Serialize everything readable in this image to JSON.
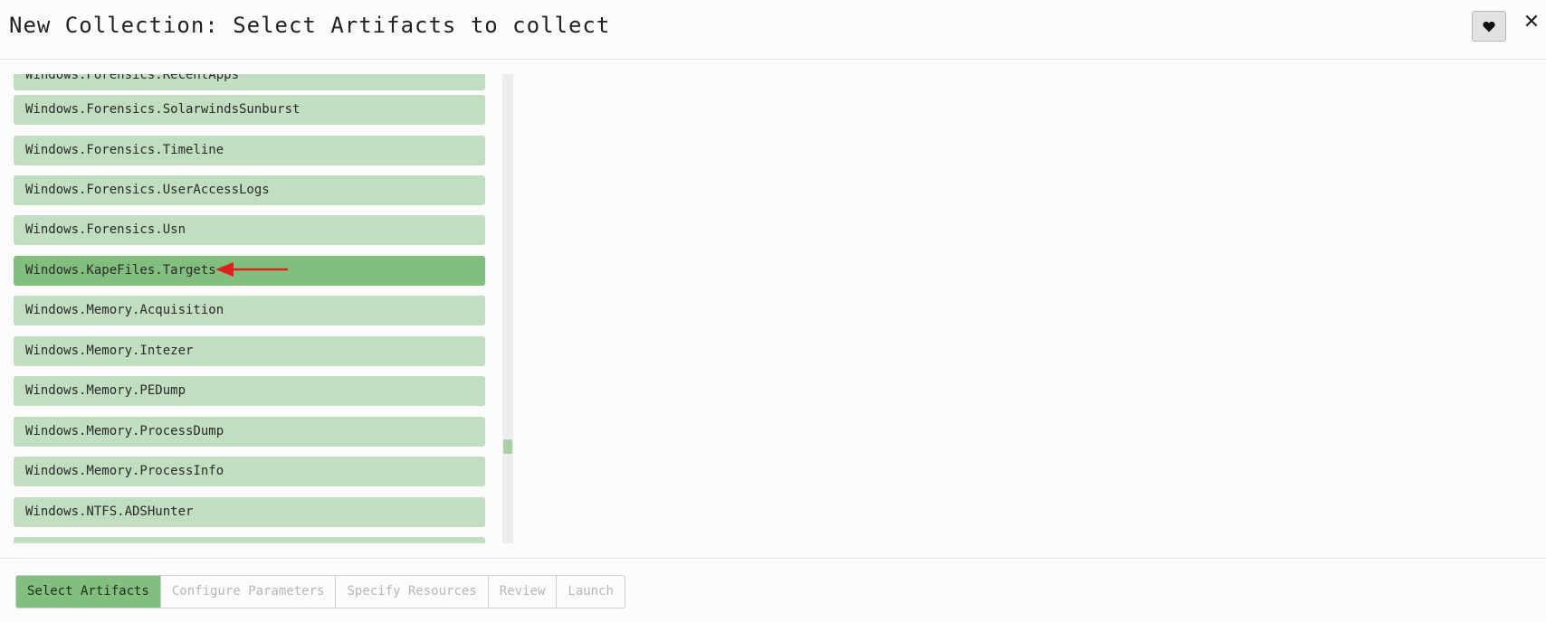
{
  "header": {
    "title": "New Collection: Select Artifacts to collect",
    "favorite_icon": "heart-icon",
    "close_label": "✕"
  },
  "artifact_list": {
    "partial_top_item": "Windows.Forensics.RecentApps",
    "items": [
      {
        "label": "Windows.Forensics.SolarwindsSunburst",
        "selected": false
      },
      {
        "label": "Windows.Forensics.Timeline",
        "selected": false
      },
      {
        "label": "Windows.Forensics.UserAccessLogs",
        "selected": false
      },
      {
        "label": "Windows.Forensics.Usn",
        "selected": false
      },
      {
        "label": "Windows.KapeFiles.Targets",
        "selected": true
      },
      {
        "label": "Windows.Memory.Acquisition",
        "selected": false
      },
      {
        "label": "Windows.Memory.Intezer",
        "selected": false
      },
      {
        "label": "Windows.Memory.PEDump",
        "selected": false
      },
      {
        "label": "Windows.Memory.ProcessDump",
        "selected": false
      },
      {
        "label": "Windows.Memory.ProcessInfo",
        "selected": false
      },
      {
        "label": "Windows.NTFS.ADSHunter",
        "selected": false
      }
    ],
    "colors": {
      "item_bg": "#c1dec0",
      "selected_bg": "#82be7e",
      "annotation_arrow": "#e0201b"
    }
  },
  "wizard_steps": [
    {
      "label": "Select Artifacts",
      "active": true
    },
    {
      "label": "Configure Parameters",
      "active": false
    },
    {
      "label": "Specify Resources",
      "active": false
    },
    {
      "label": "Review",
      "active": false
    },
    {
      "label": "Launch",
      "active": false
    }
  ]
}
